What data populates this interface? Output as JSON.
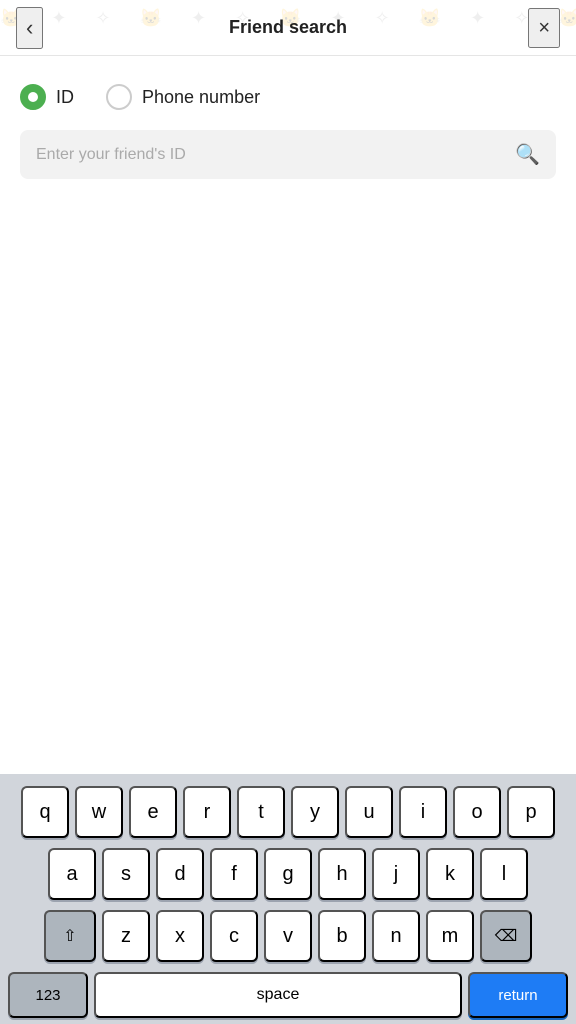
{
  "header": {
    "title": "Friend search",
    "back_icon": "‹",
    "close_icon": "×"
  },
  "radio_group": {
    "option_id": {
      "label": "ID",
      "selected": true
    },
    "option_phone": {
      "label": "Phone number",
      "selected": false
    }
  },
  "search": {
    "placeholder": "Enter your friend's ID",
    "value": ""
  },
  "keyboard": {
    "row1": [
      "q",
      "w",
      "e",
      "r",
      "t",
      "y",
      "u",
      "i",
      "o",
      "p"
    ],
    "row2": [
      "a",
      "s",
      "d",
      "f",
      "g",
      "h",
      "j",
      "k",
      "l"
    ],
    "row3": [
      "z",
      "x",
      "c",
      "v",
      "b",
      "n",
      "m"
    ],
    "bottom": {
      "num_label": "123",
      "space_label": "space",
      "return_label": "return"
    }
  },
  "colors": {
    "accent_green": "#4CAF50",
    "accent_blue": "#1e7cf5",
    "key_bg": "#ffffff",
    "special_key_bg": "#adb5bd",
    "keyboard_bg": "#d1d5db"
  }
}
